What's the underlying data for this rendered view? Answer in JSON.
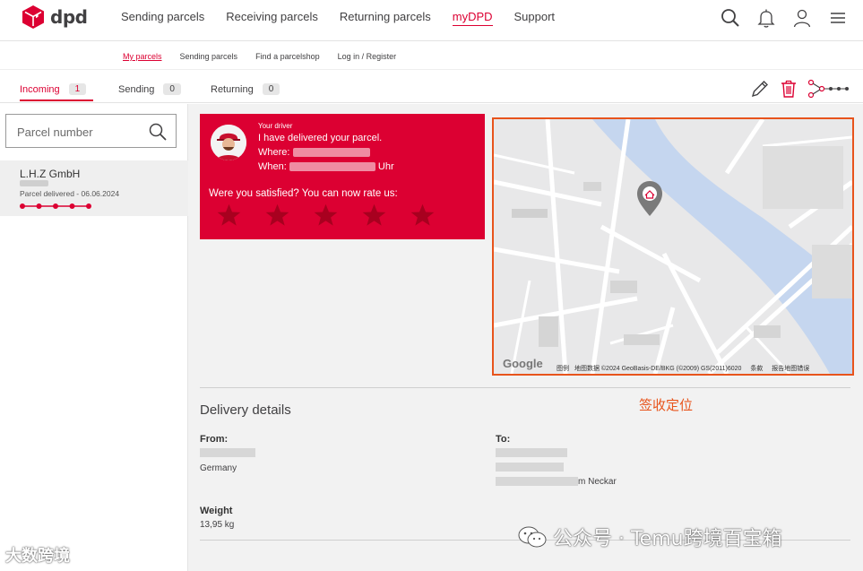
{
  "brand": {
    "name": "dpd",
    "accent": "#dc0032"
  },
  "main_nav": {
    "sending": "Sending parcels",
    "receiving": "Receiving parcels",
    "returning": "Returning parcels",
    "mydpd": "myDPD",
    "support": "Support"
  },
  "header_icons": [
    "search-icon",
    "bell-icon",
    "user-icon",
    "menu-icon"
  ],
  "sub_nav": {
    "my_parcels": "My parcels",
    "sending": "Sending parcels",
    "parcelshop": "Find a parcelshop",
    "login": "Log in / Register"
  },
  "tabs": [
    {
      "label": "Incoming",
      "count": "1"
    },
    {
      "label": "Sending",
      "count": "0"
    },
    {
      "label": "Returning",
      "count": "0"
    }
  ],
  "tab_actions": [
    "edit-icon",
    "trash-icon",
    "share-icon"
  ],
  "search": {
    "placeholder": "Parcel number"
  },
  "parcel": {
    "sender": "L.H.Z GmbH",
    "status": "Parcel delivered - 06.06.2024",
    "progress_steps_done": 5,
    "progress_steps_total": 5
  },
  "driver": {
    "label": "Your driver",
    "message": "I have delivered your parcel.",
    "where_prefix": "Where: ",
    "when_prefix": "When: ",
    "when_suffix": " Uhr",
    "rate_prompt": "Were you satisfied? You can now rate us:",
    "stars": 5
  },
  "map": {
    "footer": "地图数据 ©2024 GeoBasis-DE/BKG (©2009) GS(2011)6020",
    "footer_terms": "条款",
    "footer_report": "报告地图错误",
    "footer_scale": "图例",
    "provider": "Google",
    "annotation": "签收定位",
    "annotation_color": "#e8541c"
  },
  "delivery": {
    "title": "Delivery details",
    "from_label": "From:",
    "from_country": "Germany",
    "to_label": "To:",
    "to_city_suffix": "m Neckar",
    "weight_label": "Weight",
    "weight_value": "13,95 kg"
  },
  "watermarks": {
    "left": "大数跨境",
    "right": "公众号 · Temu跨境百宝箱"
  }
}
